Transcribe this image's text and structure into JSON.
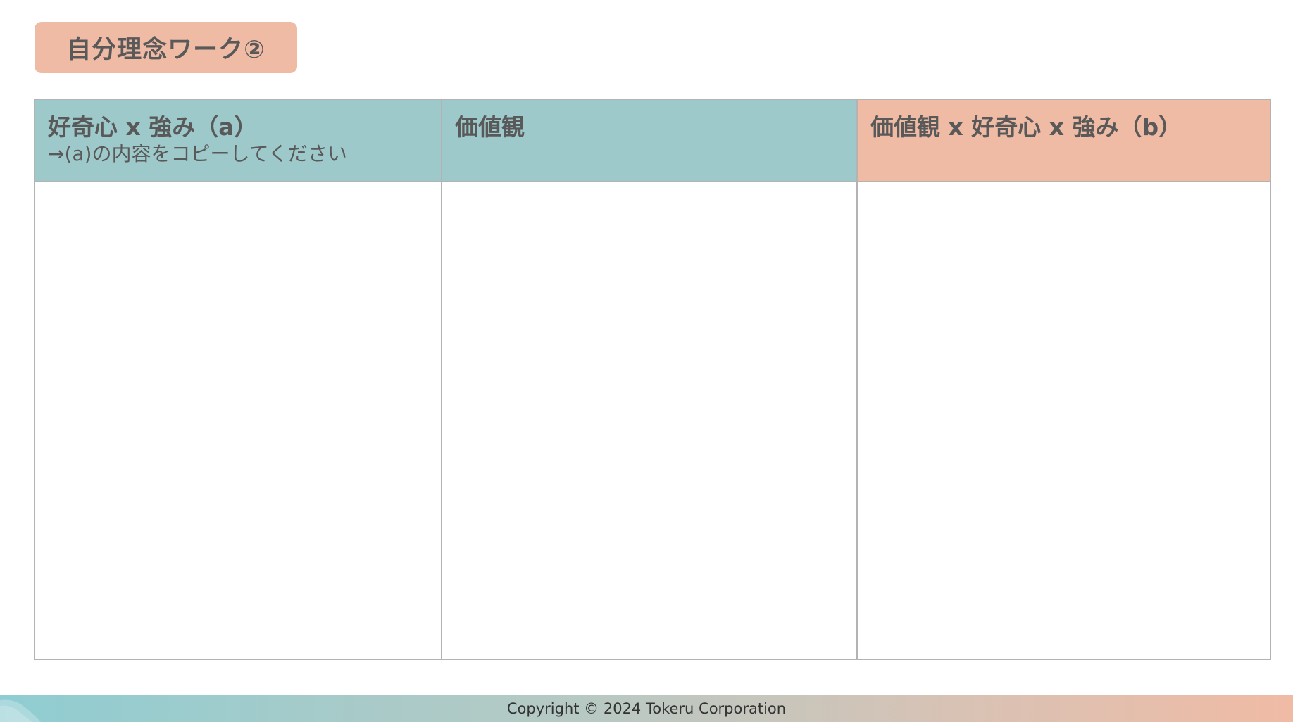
{
  "title": "自分理念ワーク②",
  "table": {
    "columns": [
      {
        "title": "好奇心 x 強み（a）",
        "note": "→(a)の内容をコピーしてください"
      },
      {
        "title": "価値観",
        "note": ""
      },
      {
        "title": "価値観 x 好奇心 x 強み（b）",
        "note": ""
      }
    ]
  },
  "footer": {
    "copyright": "Copyright © 2024 Tokeru Corporation"
  },
  "colors": {
    "teal": "#9ec9cb",
    "salmon": "#f0bba5",
    "border": "#b3b3b3",
    "text": "#595959"
  }
}
